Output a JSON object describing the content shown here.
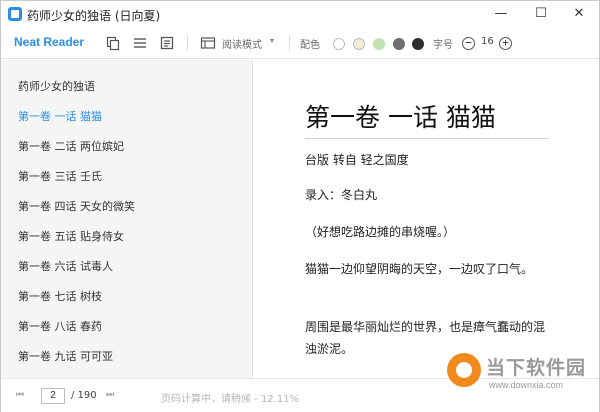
{
  "window": {
    "title": "药师少女的独语 (日向夏)",
    "minimize_glyph": "—",
    "maximize_glyph": "☐",
    "close_glyph": "✕"
  },
  "toolbar": {
    "brand": "Neat Reader",
    "mode_label": "阅读模式",
    "mode_caret": "▾",
    "color_label": "配色",
    "swatches": [
      "#ffffff",
      "#f3ead7",
      "#bde3b0",
      "#6e6e6e",
      "#2e2e2e"
    ],
    "font_size_label": "字号",
    "font_minus": "−",
    "font_size_value": "16",
    "font_plus": "+"
  },
  "sidebar": {
    "items": [
      {
        "label": "药师少女的独语",
        "active": false
      },
      {
        "label": "第一卷 一话 猫猫",
        "active": true
      },
      {
        "label": "第一卷 二话 两位嫔妃",
        "active": false
      },
      {
        "label": "第一卷 三话 壬氏",
        "active": false
      },
      {
        "label": "第一卷 四话 天女的微笑",
        "active": false
      },
      {
        "label": "第一卷 五话 贴身侍女",
        "active": false
      },
      {
        "label": "第一卷 六话 试毒人",
        "active": false
      },
      {
        "label": "第一卷 七话 树枝",
        "active": false
      },
      {
        "label": "第一卷 八话 春药",
        "active": false
      },
      {
        "label": "第一卷 九话 可可亚",
        "active": false
      }
    ]
  },
  "content": {
    "chapter_title": "第一卷 一话 猫猫",
    "paragraphs": [
      "台版 转自 轻之国度",
      "录入：冬白丸",
      "（好想吃路边摊的串烧喔。）",
      "猫猫一边仰望阴晦的天空，一边叹了口气。",
      "周围是最华丽灿烂的世界，也是瘴气蠢动的混浊淤泥。"
    ]
  },
  "statusbar": {
    "first_glyph": "⏮",
    "prev_glyph": "◀",
    "current_page": "2",
    "total_pages": "/ 190",
    "next_glyph": "⏭",
    "status_text": "页码计算中，请稍候 - 12.11%"
  },
  "watermark": {
    "text": "当下软件园",
    "url": "www.downxia.com"
  },
  "colors": {
    "accent": "#2b8fe8",
    "sidebar_bg": "#f5f5f5"
  }
}
